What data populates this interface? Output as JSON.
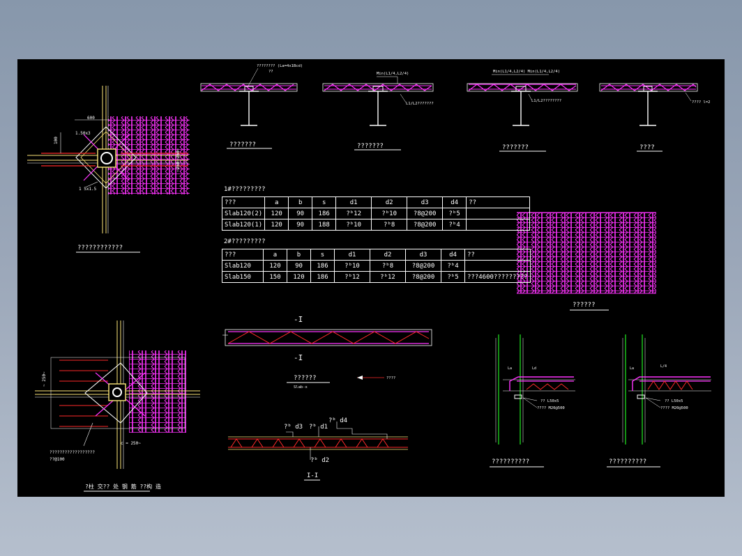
{
  "colors": {
    "background": "#000000",
    "desktop": "#8d9cb0",
    "steel": "#ff33ff",
    "red": "#ff2a2a",
    "column": "#ffe97a",
    "green": "#22ee22",
    "line": "#ffffff"
  },
  "sections": {
    "s1": {
      "title": "???????",
      "note1": "???????? (La=4x1Bcd)",
      "note2": "??"
    },
    "s2": {
      "title": "???????",
      "note1": "Min(L1/4,L2/4)",
      "note2": "L1/L2???????"
    },
    "s3": {
      "title": "???????",
      "note1": "Min(L1/4,L2/4)  Min(L1/4,L2/4)",
      "note2": "L1/L2????????"
    },
    "s4": {
      "title": "????",
      "note1": "???? l=2"
    }
  },
  "plan1": {
    "title": "????????????",
    "dims": [
      "600",
      "1.50x3",
      "100",
      "1 5x1.5",
      "250",
      "250"
    ]
  },
  "plan2": {
    "title": "?柱 交?? 处 钢 筋 ??构 造",
    "dims": [
      "~ 250~",
      "c = 250~",
      "??????????????????",
      "??@100"
    ]
  },
  "table1": {
    "title": "1#?????????",
    "headers": [
      "???",
      "a",
      "b",
      "s",
      "d1",
      "d2",
      "d3",
      "d4",
      "??"
    ],
    "rows": [
      [
        "Slab120(2)",
        "120",
        "90",
        "186",
        "?ᵇ12",
        "?ᵇ10",
        "?8@200",
        "?ᵇ5",
        ""
      ],
      [
        "Slab120(1)",
        "120",
        "90",
        "188",
        "?ᵇ10",
        "?ᵇ8",
        "?8@200",
        "?ᵇ4",
        ""
      ]
    ]
  },
  "table2": {
    "title": "2#?????????",
    "headers": [
      "???",
      "a",
      "b",
      "s",
      "d1",
      "d2",
      "d3",
      "d4",
      "??"
    ],
    "rows": [
      [
        "Slab120",
        "120",
        "90",
        "186",
        "?ᵇ10",
        "?ᵇ8",
        "?8@200",
        "?ᵇ4",
        ""
      ],
      [
        "Slab150",
        "150",
        "120",
        "186",
        "?ᵇ12",
        "?ᵇ12",
        "?8@200",
        "?ᵇ5",
        "???4600?????????"
      ]
    ]
  },
  "mesh": {
    "title": "??????"
  },
  "truss": {
    "title": "??????",
    "subtitle": "Slab-x",
    "arrow_label": "????",
    "cut_top": "-I",
    "cut_bottom": "-I"
  },
  "section_11": {
    "title": "I-I",
    "labels": {
      "d3": "?ᵇ d3",
      "d1": "?ᵇ d1",
      "d4": "?ᵇ d4",
      "d2": "?ᵇ d2"
    }
  },
  "detail1": {
    "title": "??????????",
    "labels": [
      "La",
      "Ld",
      "?? L50x5",
      "???? M20@500"
    ]
  },
  "detail2": {
    "title": "??????????",
    "labels": [
      "La",
      "L/4",
      "?? L50x5",
      "???? M20@500"
    ]
  }
}
